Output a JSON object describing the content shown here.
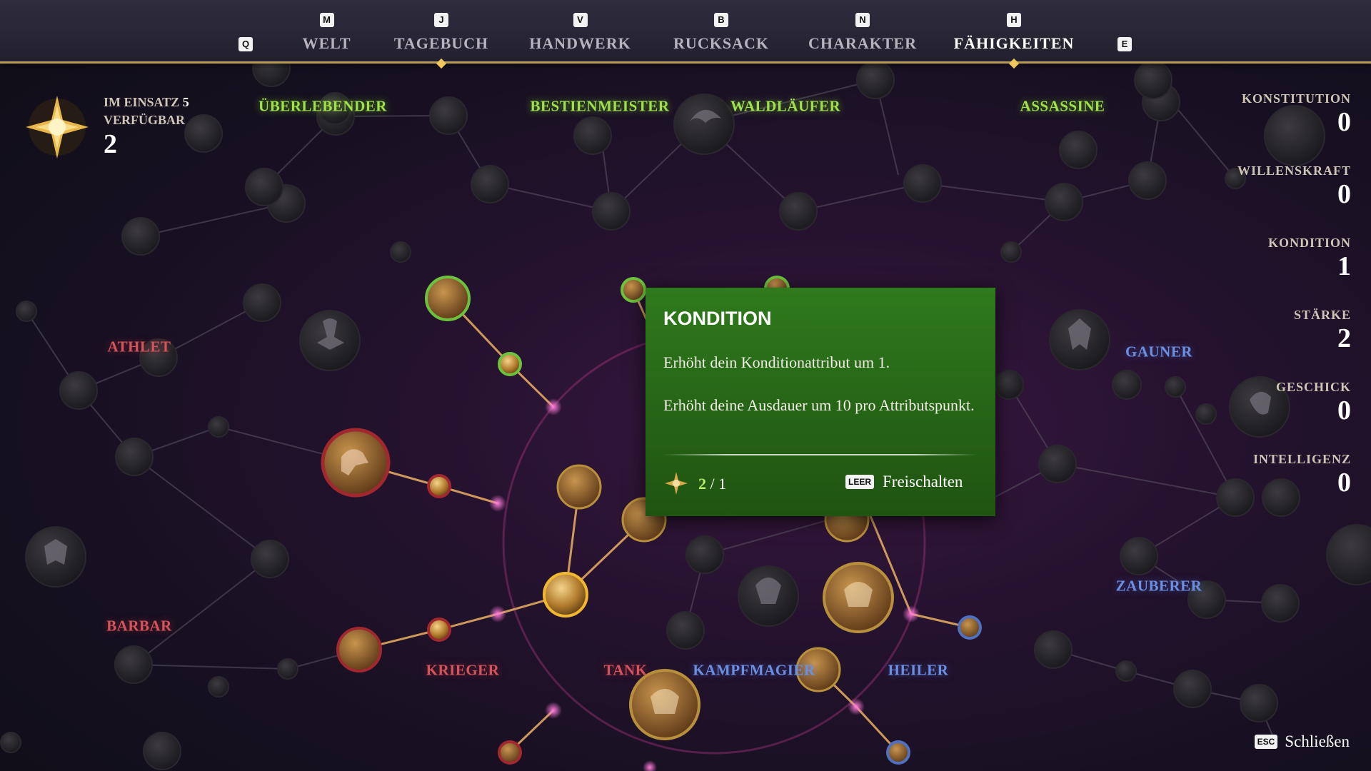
{
  "nav": {
    "left_key": "Q",
    "right_key": "E",
    "tabs": [
      {
        "key": "M",
        "label": "WELT"
      },
      {
        "key": "J",
        "label": "TAGEBUCH"
      },
      {
        "key": "V",
        "label": "HANDWERK"
      },
      {
        "key": "B",
        "label": "RUCKSACK"
      },
      {
        "key": "N",
        "label": "CHARAKTER"
      },
      {
        "key": "H",
        "label": "FÄHIGKEITEN"
      }
    ],
    "active_tab": "FÄHIGKEITEN"
  },
  "points": {
    "in_use_label": "IM EINSATZ",
    "in_use_value": "5",
    "available_label": "VERFÜGBAR",
    "available_value": "2"
  },
  "classes": {
    "ueberlebender": "ÜBERLEBENDER",
    "bestienmeister": "BESTIENMEISTER",
    "waldlaeufer": "WALDLÄUFER",
    "assassine": "ASSASSINE",
    "athlet": "ATHLET",
    "gauner": "GAUNER",
    "barbar": "BARBAR",
    "zauberer": "ZAUBERER",
    "krieger": "KRIEGER",
    "tank": "TANK",
    "kampfmagier": "KAMPFMAGIER",
    "heiler": "HEILER"
  },
  "attributes": [
    {
      "name": "KONSTITUTION",
      "value": "0"
    },
    {
      "name": "WILLENSKRAFT",
      "value": "0"
    },
    {
      "name": "KONDITION",
      "value": "1"
    },
    {
      "name": "STÄRKE",
      "value": "2"
    },
    {
      "name": "GESCHICK",
      "value": "0"
    },
    {
      "name": "INTELLIGENZ",
      "value": "0"
    }
  ],
  "tooltip": {
    "title": "KONDITION",
    "desc1": "Erhöht dein Konditionattribut um 1.",
    "desc2": "Erhöht deine Ausdauer um 10 pro Attributspunkt.",
    "cost_have": "2",
    "cost_need": "/ 1",
    "key": "LEER",
    "action": "Freischalten"
  },
  "close": {
    "key": "ESC",
    "label": "Schließen"
  },
  "colors": {
    "tooltip_bg": "#276617",
    "accent_gold": "#f0c75a",
    "class_green": "#9fe04b",
    "class_red": "#d4545c",
    "class_blue": "#6d8fe0"
  }
}
